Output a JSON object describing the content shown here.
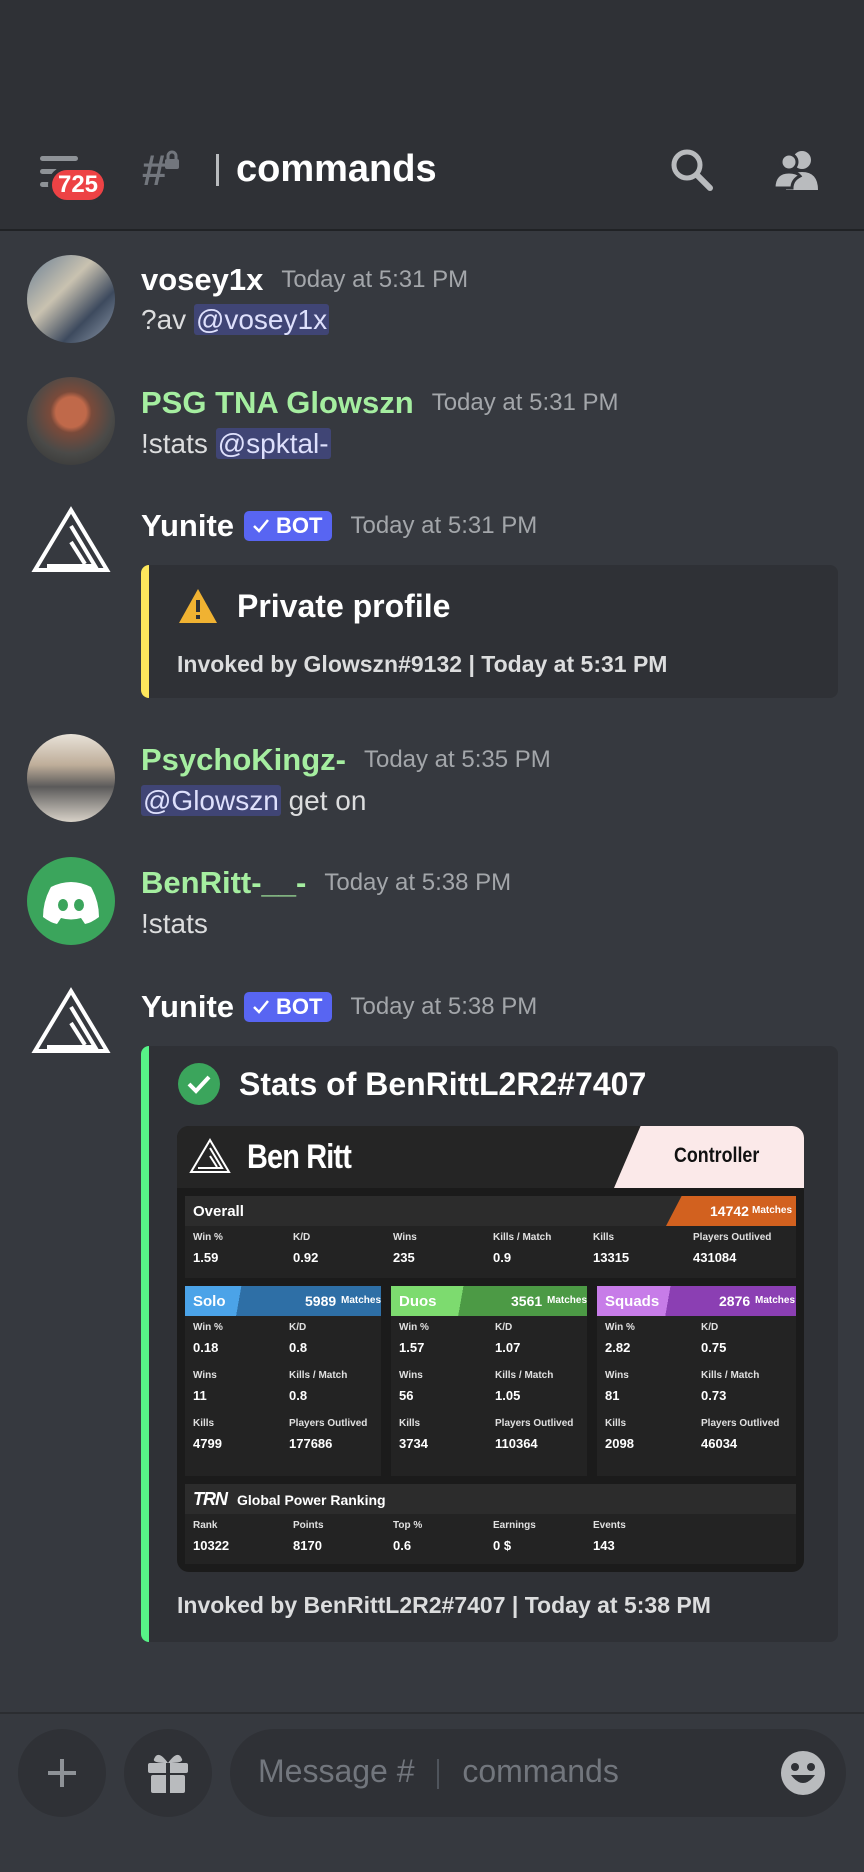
{
  "header": {
    "unread_badge": "725",
    "channel_name": "commands",
    "search_icon": "search-icon",
    "members_icon": "members-icon"
  },
  "messages": [
    {
      "author": "vosey1x",
      "time": "Today at 5:31 PM",
      "text": "?av ",
      "mention": "@vosey1x"
    },
    {
      "author": "PSG TNA Glowszn",
      "time": "Today at 5:31 PM",
      "text": "!stats ",
      "mention": "@spktal-"
    },
    {
      "author": "Yunite",
      "bot_tag": "BOT",
      "time": "Today at 5:31 PM",
      "embed": {
        "title": "Private profile",
        "footer": "Invoked by Glowszn#9132 | Today at 5:31 PM",
        "color": "#fee75c"
      }
    },
    {
      "author": "PsychoKingz-",
      "time": "Today at 5:35 PM",
      "mention": "@Glowszn",
      "text": " get on"
    },
    {
      "author": "BenRitt-__-",
      "time": "Today at 5:38 PM",
      "text": "!stats"
    },
    {
      "author": "Yunite",
      "bot_tag": "BOT",
      "time": "Today at 5:38 PM",
      "embed": {
        "title": "Stats of BenRittL2R2#7407",
        "footer": "Invoked by BenRittL2R2#7407 | Today at 5:38 PM",
        "color": "#57f287"
      }
    }
  ],
  "stats_card": {
    "player": "Ben Ritt",
    "input": "Controller",
    "overall": {
      "label": "Overall",
      "matches": "14742",
      "matches_label": "Matches",
      "labels": [
        "Win %",
        "K/D",
        "Wins",
        "Kills / Match",
        "Kills",
        "Players Outlived"
      ],
      "values": [
        "1.59",
        "0.92",
        "235",
        "0.9",
        "13315",
        "431084"
      ]
    },
    "modes": [
      {
        "label": "Solo",
        "matches": "5989",
        "matches_label": "Matches",
        "color": "#3a7fc4",
        "labels": [
          "Win %",
          "K/D",
          "Wins",
          "Kills / Match",
          "Kills",
          "Players Outlived"
        ],
        "values": [
          "0.18",
          "0.8",
          "11",
          "0.8",
          "4799",
          "177686"
        ]
      },
      {
        "label": "Duos",
        "matches": "3561",
        "matches_label": "Matches",
        "color": "#5cb85c",
        "labels": [
          "Win %",
          "K/D",
          "Wins",
          "Kills / Match",
          "Kills",
          "Players Outlived"
        ],
        "values": [
          "1.57",
          "1.07",
          "56",
          "1.05",
          "3734",
          "110364"
        ]
      },
      {
        "label": "Squads",
        "matches": "2876",
        "matches_label": "Matches",
        "color": "#9b4fc4",
        "labels": [
          "Win %",
          "K/D",
          "Wins",
          "Kills / Match",
          "Kills",
          "Players Outlived"
        ],
        "values": [
          "2.82",
          "0.75",
          "81",
          "0.73",
          "2098",
          "46034"
        ]
      }
    ],
    "trn": {
      "logo": "TRN",
      "label": "Global Power Ranking",
      "labels": [
        "Rank",
        "Points",
        "Top %",
        "Earnings",
        "Events"
      ],
      "values": [
        "10322",
        "8170",
        "0.6",
        "0 $",
        "143"
      ]
    }
  },
  "composer": {
    "placeholder_prefix": "Message #",
    "placeholder_channel": "commands"
  }
}
